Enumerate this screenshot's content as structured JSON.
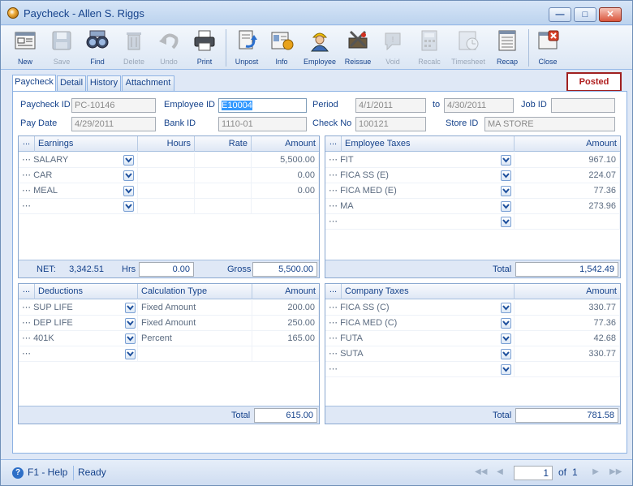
{
  "window": {
    "title": "Paycheck - Allen S. Riggs"
  },
  "toolbar": {
    "buttons": [
      {
        "label": "New",
        "icon": "new-icon",
        "enabled": true
      },
      {
        "label": "Save",
        "icon": "save-icon",
        "enabled": false
      },
      {
        "label": "Find",
        "icon": "find-icon",
        "enabled": true
      },
      {
        "label": "Delete",
        "icon": "delete-icon",
        "enabled": false
      },
      {
        "label": "Undo",
        "icon": "undo-icon",
        "enabled": false
      },
      {
        "label": "Print",
        "icon": "print-icon",
        "enabled": true
      },
      {
        "label": "Unpost",
        "icon": "unpost-icon",
        "enabled": true
      },
      {
        "label": "Info",
        "icon": "info-icon",
        "enabled": true
      },
      {
        "label": "Employee",
        "icon": "employee-icon",
        "enabled": true
      },
      {
        "label": "Reissue",
        "icon": "reissue-icon",
        "enabled": true
      },
      {
        "label": "Void",
        "icon": "void-icon",
        "enabled": false
      },
      {
        "label": "Recalc",
        "icon": "recalc-icon",
        "enabled": false
      },
      {
        "label": "Timesheet",
        "icon": "timesheet-icon",
        "enabled": false
      },
      {
        "label": "Recap",
        "icon": "recap-icon",
        "enabled": true
      },
      {
        "label": "Close",
        "icon": "close-icon",
        "enabled": true
      }
    ]
  },
  "tabs": [
    "Paycheck",
    "Detail",
    "History",
    "Attachment"
  ],
  "status_badge": "Posted",
  "form": {
    "paycheck_id_label": "Paycheck ID",
    "paycheck_id": "PC-10146",
    "employee_id_label": "Employee ID",
    "employee_id": "E10004",
    "period_label": "Period",
    "period_from": "4/1/2011",
    "period_to_label": "to",
    "period_to": "4/30/2011",
    "job_id_label": "Job ID",
    "job_id": "",
    "pay_date_label": "Pay Date",
    "pay_date": "4/29/2011",
    "bank_id_label": "Bank ID",
    "bank_id": "1110-01",
    "check_no_label": "Check No",
    "check_no": "100121",
    "store_id_label": "Store ID",
    "store_id": "MA STORE"
  },
  "earnings": {
    "headers": [
      "...",
      "Earnings",
      "Hours",
      "Rate",
      "Amount"
    ],
    "rows": [
      {
        "name": "SALARY",
        "hours": "",
        "rate": "",
        "amount": "5,500.00"
      },
      {
        "name": "CAR",
        "hours": "",
        "rate": "",
        "amount": "0.00"
      },
      {
        "name": "MEAL",
        "hours": "",
        "rate": "",
        "amount": "0.00"
      },
      {
        "name": "",
        "hours": "",
        "rate": "",
        "amount": ""
      }
    ],
    "net_label": "NET:",
    "net": "3,342.51",
    "hrs_label": "Hrs",
    "hrs": "0.00",
    "gross_label": "Gross",
    "gross": "5,500.00"
  },
  "employee_taxes": {
    "headers": [
      "...",
      "Employee Taxes",
      "Amount"
    ],
    "rows": [
      {
        "name": "FIT",
        "amount": "967.10"
      },
      {
        "name": "FICA SS (E)",
        "amount": "224.07"
      },
      {
        "name": "FICA MED (E)",
        "amount": "77.36"
      },
      {
        "name": "MA",
        "amount": "273.96"
      },
      {
        "name": "",
        "amount": ""
      }
    ],
    "total_label": "Total",
    "total": "1,542.49"
  },
  "deductions": {
    "headers": [
      "...",
      "Deductions",
      "Calculation Type",
      "Amount"
    ],
    "rows": [
      {
        "name": "SUP LIFE",
        "calc": "Fixed Amount",
        "amount": "200.00"
      },
      {
        "name": "DEP LIFE",
        "calc": "Fixed Amount",
        "amount": "250.00"
      },
      {
        "name": "401K",
        "calc": "Percent",
        "amount": "165.00"
      },
      {
        "name": "",
        "calc": "",
        "amount": ""
      }
    ],
    "total_label": "Total",
    "total": "615.00"
  },
  "company_taxes": {
    "headers": [
      "...",
      "Company Taxes",
      "Amount"
    ],
    "rows": [
      {
        "name": "FICA SS (C)",
        "amount": "330.77"
      },
      {
        "name": "FICA MED (C)",
        "amount": "77.36"
      },
      {
        "name": "FUTA",
        "amount": "42.68"
      },
      {
        "name": "SUTA",
        "amount": "330.77"
      },
      {
        "name": "",
        "amount": ""
      }
    ],
    "total_label": "Total",
    "total": "781.58"
  },
  "statusbar": {
    "help": "F1 - Help",
    "status": "Ready",
    "page": "1",
    "of_label": "of",
    "page_count": "1"
  },
  "colors": {
    "accent": "#15428b",
    "posted": "#b01e1e",
    "panel": "#dfe8f6"
  }
}
